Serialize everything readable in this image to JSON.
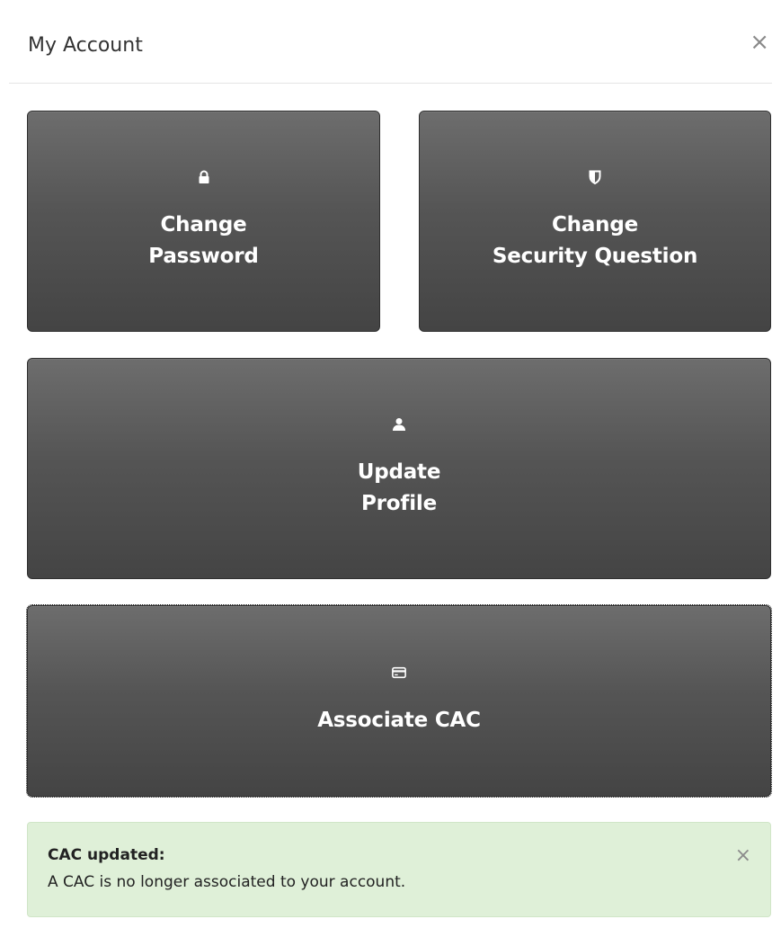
{
  "modal": {
    "title": "My Account",
    "close_symbol": "×"
  },
  "tiles": [
    {
      "icon": "lock-icon",
      "lines": [
        "Change",
        "Password"
      ]
    },
    {
      "icon": "shield-icon",
      "lines": [
        "Change",
        "Security Question"
      ]
    },
    {
      "icon": "user-icon",
      "lines": [
        "Update",
        "Profile"
      ]
    },
    {
      "icon": "credit-card-icon",
      "lines": [
        "Associate CAC"
      ]
    }
  ],
  "alert": {
    "title": "CAC updated:",
    "message": "A CAC is no longer associated to your account.",
    "close_symbol": "×"
  },
  "colors": {
    "tile_top": "#6d6d6d",
    "tile_bottom": "#444444",
    "alert_background": "#dff0d8",
    "text": "#333333"
  }
}
